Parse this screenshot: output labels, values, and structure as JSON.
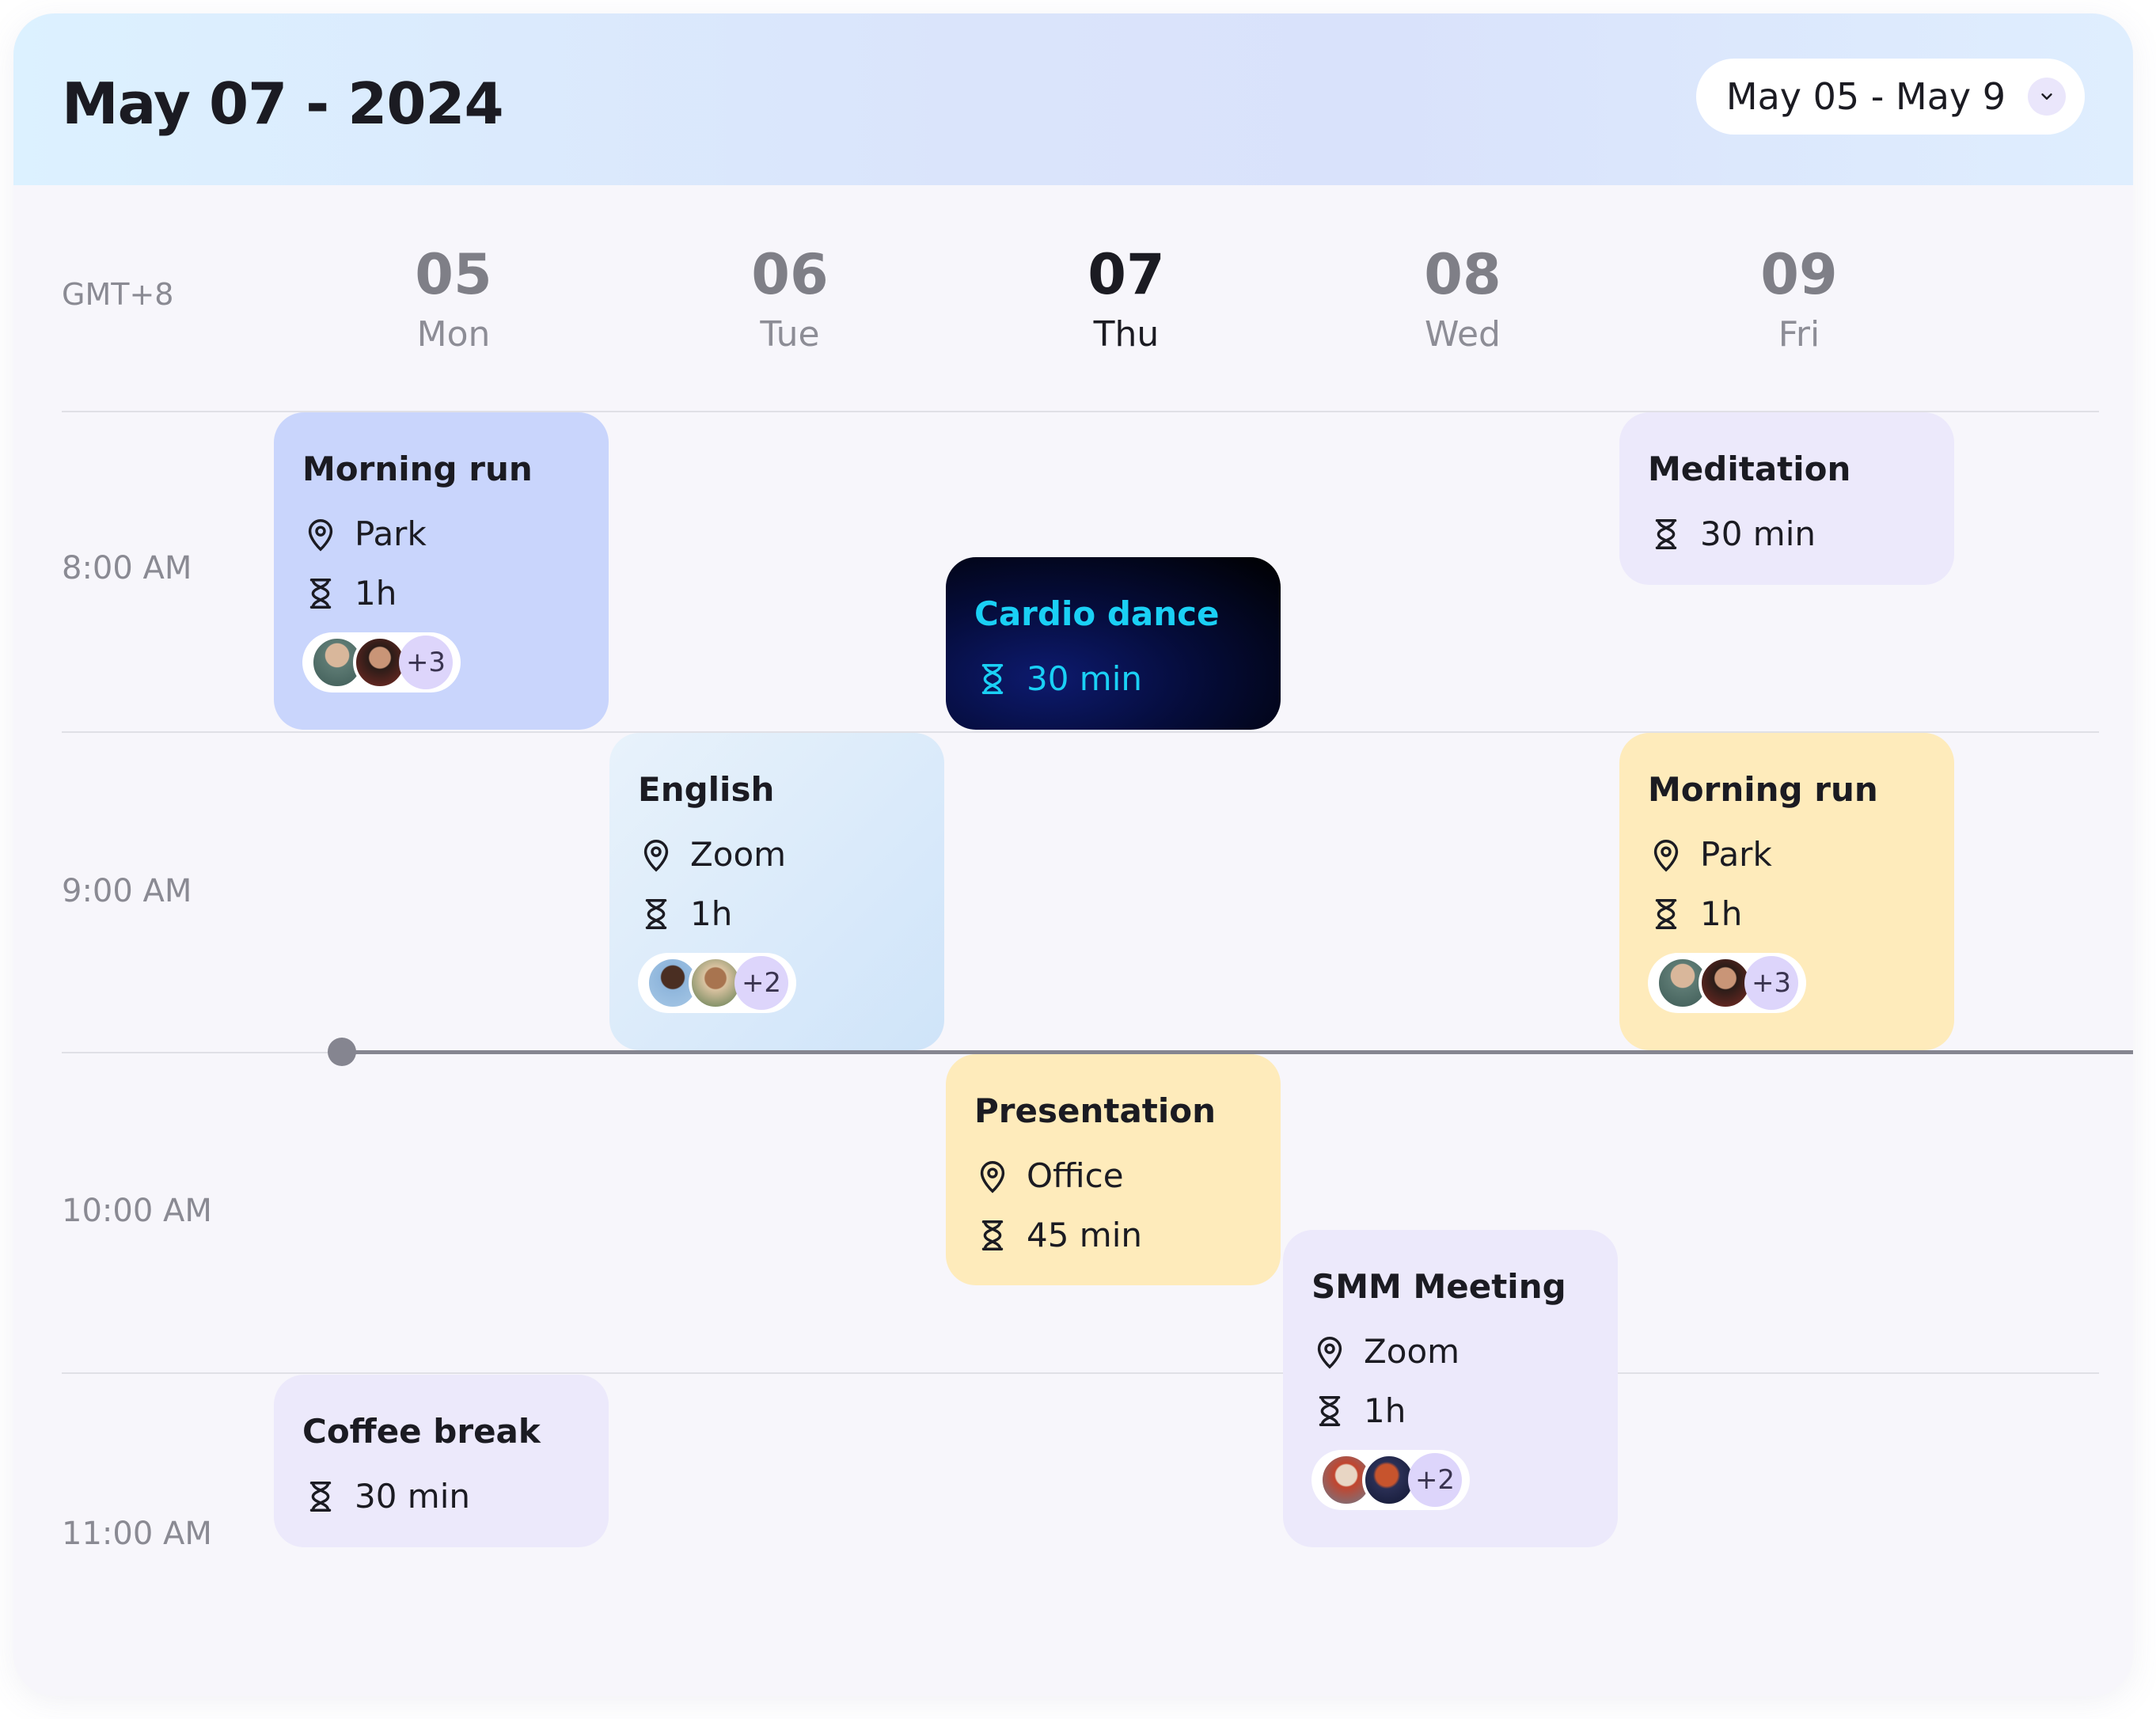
{
  "header": {
    "title": "May 07 - 2024",
    "range_label": "May 05 - May 9"
  },
  "timezone": "GMT+8",
  "days": [
    {
      "num": "05",
      "name": "Mon"
    },
    {
      "num": "06",
      "name": "Tue"
    },
    {
      "num": "07",
      "name": "Thu"
    },
    {
      "num": "08",
      "name": "Wed"
    },
    {
      "num": "09",
      "name": "Fri"
    }
  ],
  "times": [
    "8:00 AM",
    "9:00 AM",
    "10:00 AM",
    "11:00 AM"
  ],
  "events": {
    "morning_run_mon": {
      "title": "Morning run",
      "location": "Park",
      "duration": "1h",
      "more": "+3"
    },
    "cardio_dance": {
      "title": "Cardio dance",
      "duration": "30 min"
    },
    "meditation": {
      "title": "Meditation",
      "duration": "30 min"
    },
    "english": {
      "title": "English",
      "location": "Zoom",
      "duration": "1h",
      "more": "+2"
    },
    "morning_run_fri": {
      "title": "Morning run",
      "location": "Park",
      "duration": "1h",
      "more": "+3"
    },
    "presentation": {
      "title": "Presentation",
      "location": "Office",
      "duration": "45 min"
    },
    "smm_meeting": {
      "title": "SMM Meeting",
      "location": "Zoom",
      "duration": "1h",
      "more": "+2"
    },
    "coffee_break": {
      "title": "Coffee break",
      "duration": "30 min"
    }
  },
  "colors": {
    "blue_event": "#c9d5fc",
    "lavender_event": "#ece9fb",
    "yellow_event": "#feebbb",
    "cardio_text": "#1ad0f5",
    "now_line": "#858590"
  }
}
